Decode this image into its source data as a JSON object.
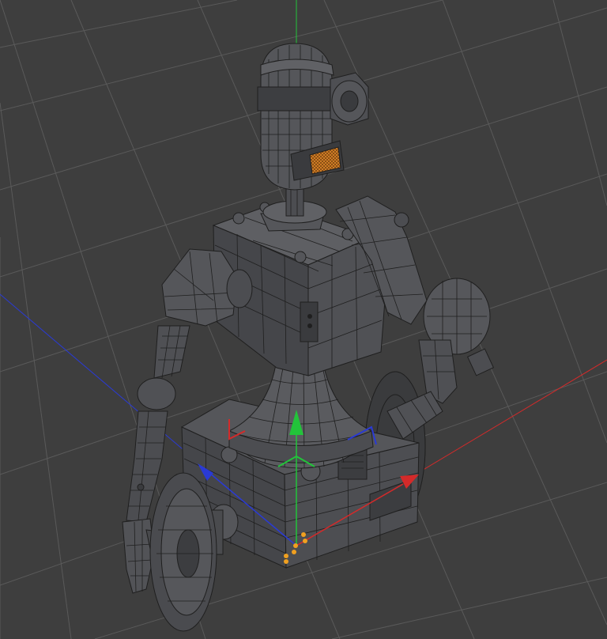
{
  "viewport": {
    "background": "#3e3e3e",
    "grid_color": "#5a5a5a",
    "model_fill": "#4a4b4d",
    "model_fill_light": "#5a5b5e",
    "model_fill_dark": "#38393b",
    "wire_color": "#1f1f1f",
    "visor_color": "#e0882a",
    "axis_colors": {
      "x": "#d42a2a",
      "y": "#22c43a",
      "z": "#2a3ad4"
    },
    "selection_point_color": "#f0a020"
  },
  "model": {
    "parts": [
      "head",
      "visor",
      "ear-disc",
      "neck",
      "torso",
      "left-shoulder",
      "right-shoulder",
      "left-arm",
      "right-arm",
      "left-hand",
      "waist-cone",
      "base-box",
      "left-wheel",
      "right-wheel"
    ]
  },
  "gizmo": {
    "icons": [
      "move-y-arrow-icon",
      "move-x-arrow-icon",
      "move-z-arrow-icon",
      "plane-handle-xy-icon",
      "plane-handle-zy-icon"
    ]
  }
}
